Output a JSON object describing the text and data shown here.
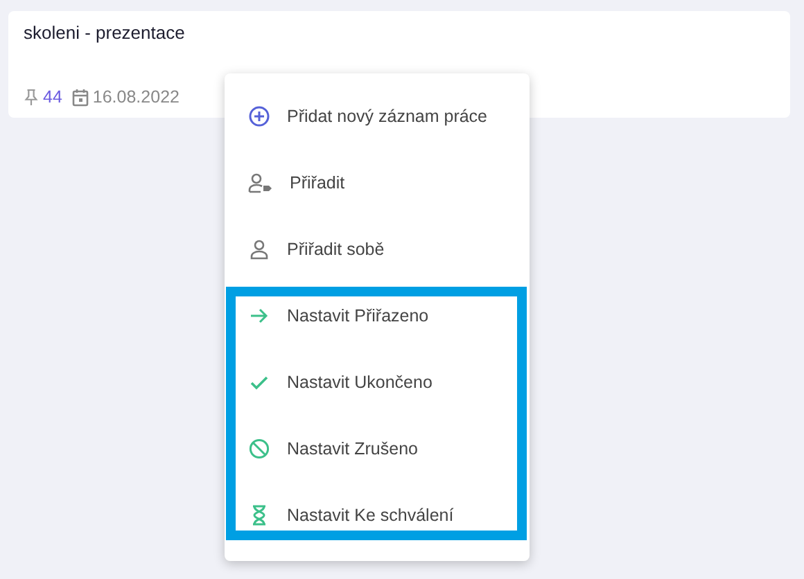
{
  "card": {
    "title": "skoleni - prezentace",
    "pin_count": "44",
    "date": "16.08.2022"
  },
  "menu": {
    "items": [
      {
        "label": "Přidat nový záznam práce",
        "kind": "add",
        "highlighted": false
      },
      {
        "label": "Přiřadit",
        "kind": "assign",
        "highlighted": false
      },
      {
        "label": "Přiřadit sobě",
        "kind": "assign-self",
        "highlighted": false
      },
      {
        "label": "Nastavit Přiřazeno",
        "kind": "arrow",
        "highlighted": true
      },
      {
        "label": "Nastavit Ukončeno",
        "kind": "check",
        "highlighted": true
      },
      {
        "label": "Nastavit Zrušeno",
        "kind": "cancel",
        "highlighted": true
      },
      {
        "label": "Nastavit Ke schválení",
        "kind": "hourglass",
        "highlighted": true
      }
    ]
  }
}
